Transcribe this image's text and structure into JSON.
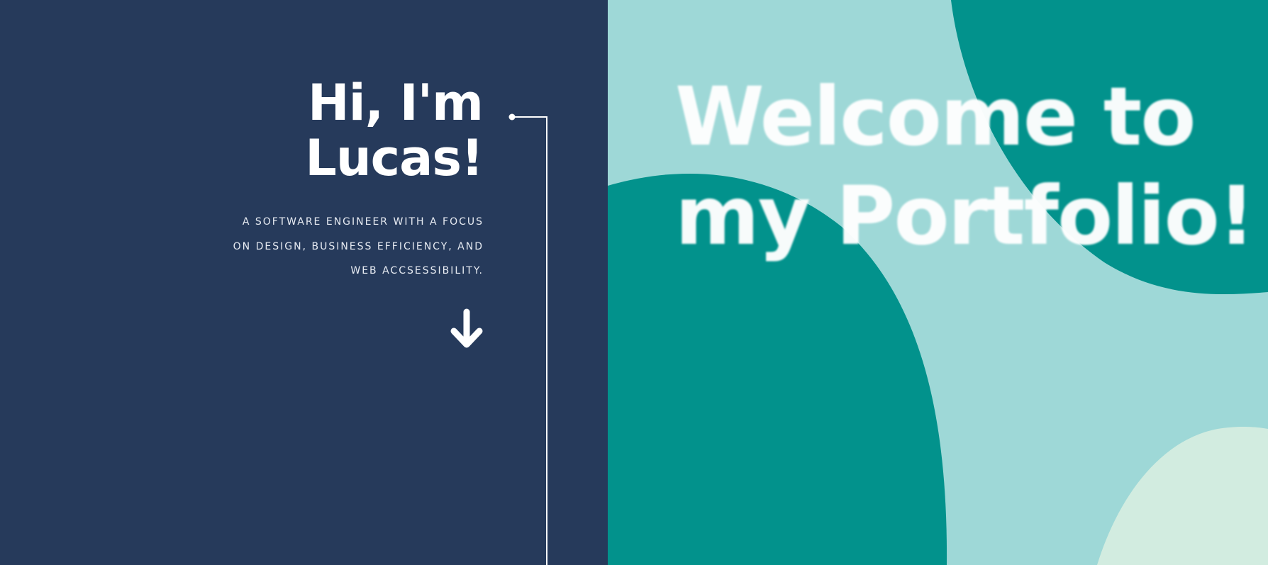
{
  "hero": {
    "heading_line1": "Hi, I'm",
    "heading_line2": "Lucas!",
    "subtitle": "A Software Engineer with a focus on design, business efficiency, and web accsessibility.",
    "scroll_icon": "arrow-down-icon"
  },
  "banner": {
    "welcome_line1": "Welcome to",
    "welcome_line2": "my Portfolio!"
  },
  "colors": {
    "left_background": "#263a5b",
    "teal_dark": "#02928c",
    "teal_light": "#9ed8d7",
    "mint": "#d2ece0",
    "text": "#ffffff"
  }
}
